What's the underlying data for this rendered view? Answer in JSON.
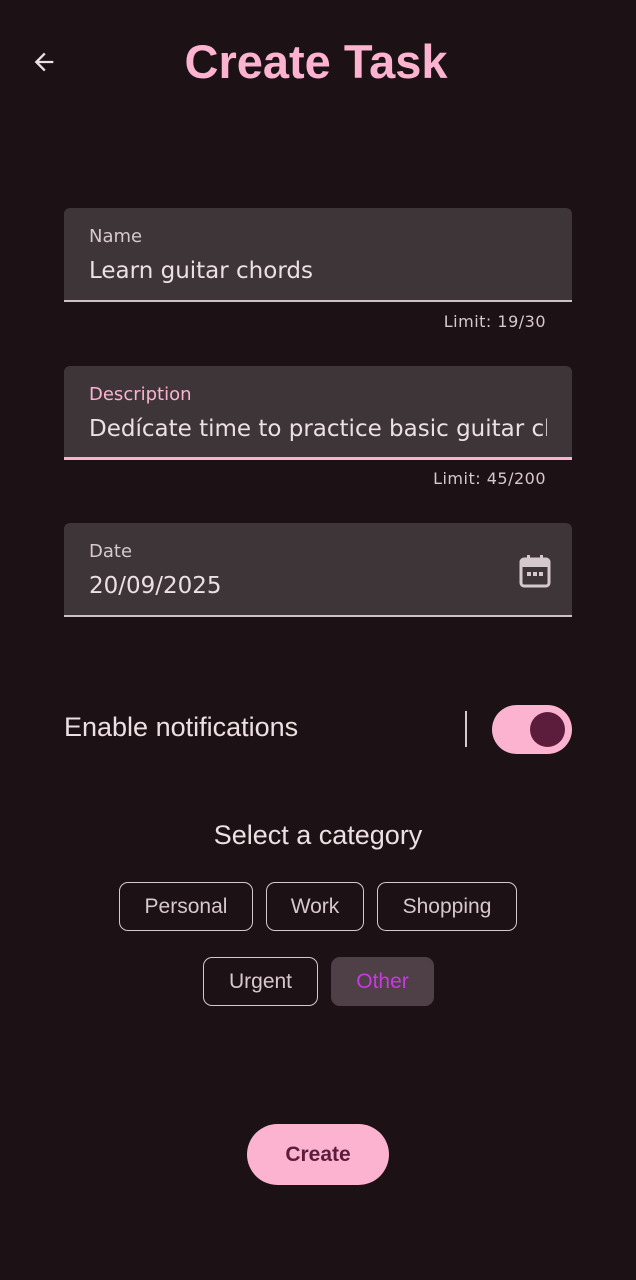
{
  "header": {
    "title": "Create Task",
    "back_icon": "arrow-back-icon"
  },
  "form": {
    "name": {
      "label": "Name",
      "value": "Learn guitar chords",
      "limit": "Limit: 19/30"
    },
    "description": {
      "label": "Description",
      "value": "Dedícate time to practice basic guitar chords",
      "limit": "Limit: 45/200"
    },
    "date": {
      "label": "Date",
      "value": "20/09/2025",
      "icon": "calendar-icon"
    }
  },
  "notifications": {
    "label": "Enable notifications",
    "enabled": true
  },
  "categories": {
    "title": "Select a category",
    "items": [
      "Personal",
      "Work",
      "Shopping",
      "Urgent",
      "Other"
    ],
    "selected": "Other"
  },
  "actions": {
    "create_label": "Create"
  },
  "colors": {
    "background": "#1c1114",
    "accent": "#fbb3d0",
    "field_background": "#3e3539",
    "selected_chip_text": "#c63adf",
    "toggle_thumb": "#5c1d3d"
  }
}
